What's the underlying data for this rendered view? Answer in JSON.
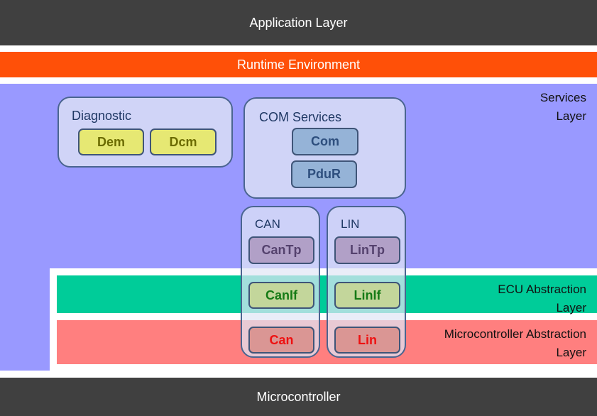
{
  "layers": {
    "application": "Application Layer",
    "runtime": "Runtime Environment",
    "services": [
      "Services",
      "Layer"
    ],
    "ecu_abstraction": [
      "ECU Abstraction",
      "Layer"
    ],
    "mcal": [
      "Microcontroller Abstraction",
      "Layer"
    ],
    "microcontroller": "Microcontroller"
  },
  "groups": {
    "diagnostic": {
      "title": "Diagnostic",
      "modules": [
        "Dem",
        "Dcm"
      ]
    },
    "com_services": {
      "title": "COM Services",
      "modules": [
        "Com",
        "PduR"
      ]
    },
    "can": {
      "title": "CAN",
      "modules": [
        "CanTp",
        "CanIf",
        "Can"
      ]
    },
    "lin": {
      "title": "LIN",
      "modules": [
        "LinTp",
        "LinIf",
        "Lin"
      ]
    }
  },
  "colors": {
    "dark_bar": "#404040",
    "runtime": "#ff5008",
    "services": "#9999ff",
    "ecu_abstraction": "#00cc99",
    "mcal": "#ff7f7f"
  }
}
